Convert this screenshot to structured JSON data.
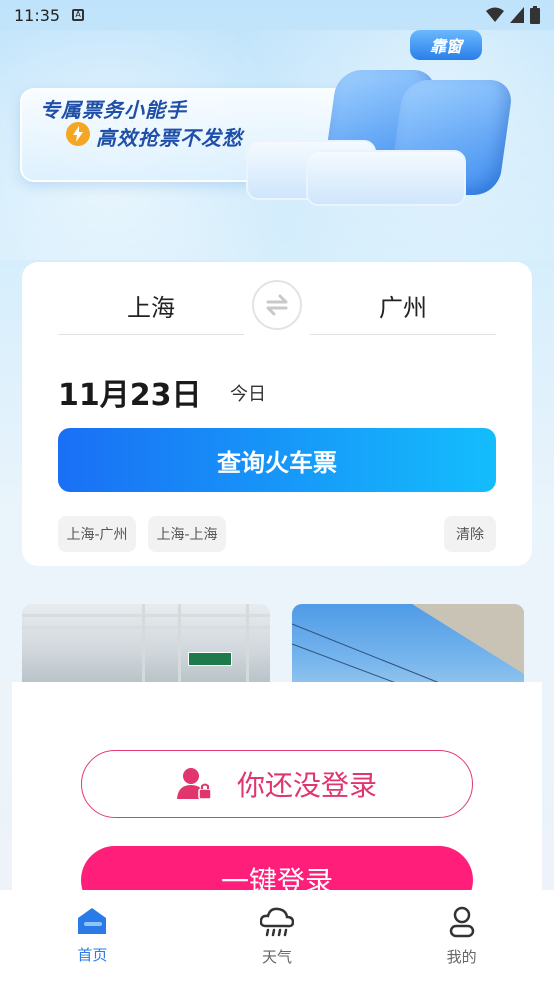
{
  "status_bar": {
    "time": "11:35"
  },
  "banner": {
    "slogan_line1": "专属票务小能手",
    "slogan_line2": "高效抢票不发愁",
    "window_tag": "靠窗"
  },
  "search": {
    "from_city": "上海",
    "to_city": "广州",
    "date": "11月23日",
    "date_label": "今日",
    "query_button": "查询火车票",
    "history": [
      "上海-广州",
      "上海-上海"
    ],
    "clear_label": "清除"
  },
  "login": {
    "status_text": "你还没登录",
    "one_click_label": "一键登录"
  },
  "bottom_nav": {
    "items": [
      {
        "label": "首页",
        "icon": "home-icon",
        "active": true
      },
      {
        "label": "天气",
        "icon": "weather-icon",
        "active": false
      },
      {
        "label": "我的",
        "icon": "profile-icon",
        "active": false
      }
    ]
  },
  "colors": {
    "accent_blue": "#1a6ff5",
    "accent_cyan": "#14bdfc",
    "login_pink": "#ff1f7a",
    "nav_active": "#2a7be8"
  }
}
